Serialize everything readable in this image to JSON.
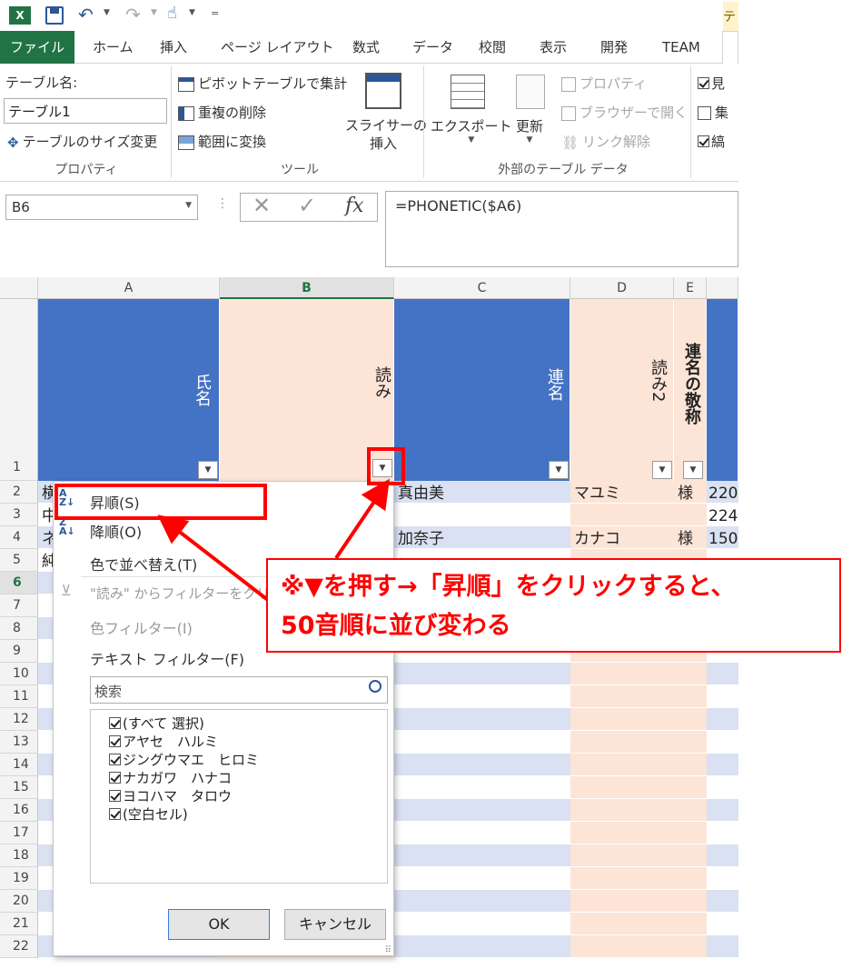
{
  "quickaccess": {
    "excel_icon": "excel-icon",
    "save_icon": "save-icon",
    "undo_icon": "undo-icon",
    "redo_icon": "redo-icon",
    "touch_icon": "touch-mode-icon",
    "customize_icon": "customize-icon",
    "right_tab_fragment": "テ"
  },
  "tabs": [
    "ファイル",
    "ホーム",
    "挿入",
    "ページ レイアウト",
    "数式",
    "データ",
    "校閲",
    "表示",
    "開発",
    "TEAM"
  ],
  "ribbon": {
    "table_name_label": "テーブル名:",
    "table_name_value": "テーブル1",
    "resize_table": "テーブルのサイズ変更",
    "group_properties": "プロパティ",
    "pivot": "ピボットテーブルで集計",
    "remove_duplicates": "重複の削除",
    "convert_range": "範囲に変換",
    "slicer_line1": "スライサーの",
    "slicer_line2": "挿入",
    "group_tools": "ツール",
    "export": "エクスポート",
    "refresh": "更新",
    "properties": "プロパティ",
    "open_browser": "ブラウザーで開く",
    "unlink": "リンク解除",
    "group_external": "外部のテーブル データ",
    "check1": "見",
    "check2": "集",
    "check3": "縞"
  },
  "formula": {
    "name_box": "B6",
    "fx": "fx",
    "value": "=PHONETIC($A6)"
  },
  "columns": [
    "A",
    "B",
    "C",
    "D",
    "E"
  ],
  "header": {
    "a": "氏名",
    "b": "読み",
    "c": "連名",
    "d": "読み2",
    "e": "連名の敬称"
  },
  "rows": [
    "1",
    "2",
    "3",
    "4",
    "5",
    "6",
    "7",
    "8",
    "9",
    "10",
    "11",
    "12",
    "13",
    "14",
    "15",
    "16",
    "17",
    "18",
    "19",
    "20",
    "21",
    "22"
  ],
  "cells": {
    "a2": "横",
    "a3": "中",
    "a4": "ネ",
    "a5": "純",
    "c2": "真由美",
    "d2": "マユミ",
    "e2": "様",
    "f2": "220",
    "f3": "224",
    "c4": "加奈子",
    "d4": "カナコ",
    "e4": "様",
    "f4": "150"
  },
  "menu": {
    "sort_asc": "昇順(S)",
    "sort_desc": "降順(O)",
    "sort_color": "色で並べ替え(T)",
    "clear_filter": "\"読み\" からフィルターをクリア(",
    "color_filter": "色フィルター(I)",
    "text_filter": "テキスト フィルター(F)",
    "search_placeholder": "検索",
    "list": [
      "(すべて 選択)",
      "アヤセ　ハルミ",
      "ジングウマエ　ヒロミ",
      "ナカガワ　ハナコ",
      "ヨコハマ　タロウ",
      "(空白セル)"
    ],
    "ok": "OK",
    "cancel": "キャンセル"
  },
  "callout": {
    "line1": "※▼を押す→「昇順」をクリックすると、",
    "line2": "50音順に並び変わる"
  },
  "colors": {
    "excel_green": "#217346",
    "header_blue": "#4472c4",
    "peach": "#fce4d6",
    "band_blue": "#d9e1f2",
    "red": "#ff0000"
  }
}
